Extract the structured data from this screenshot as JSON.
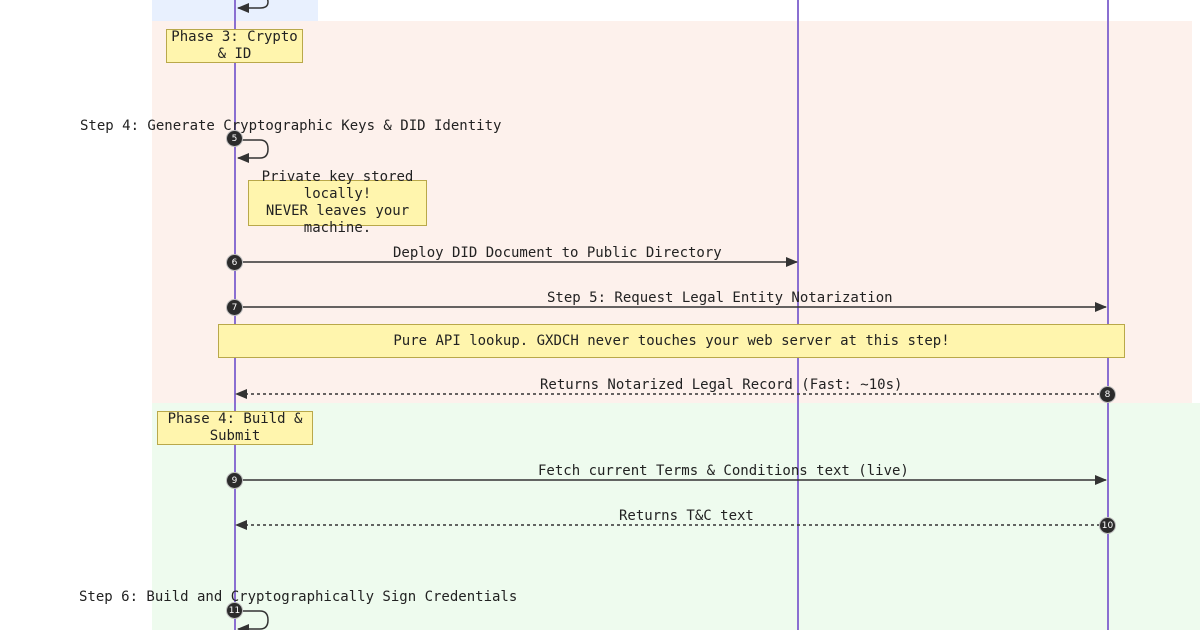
{
  "colors": {
    "band_top": "#e8f0fe",
    "band_phase3": "#fdf1ec",
    "band_phase4": "#eefbee",
    "note_fill": "#fff5ad",
    "lifeline": "#8a6fd1",
    "arrow": "#333333",
    "badge": "#2b2b2b"
  },
  "notes": {
    "phase3": "Phase 3: Crypto & ID",
    "private_key_line1": "Private key stored locally!",
    "private_key_line2": "NEVER leaves your machine.",
    "pure_api": "Pure API lookup. GXDCH never touches your web server at this step!",
    "phase4": "Phase 4: Build & Submit"
  },
  "messages": {
    "step4": "Step 4: Generate Cryptographic Keys & DID Identity",
    "deploy_did": "Deploy DID Document to Public Directory",
    "step5": "Step 5: Request Legal Entity Notarization",
    "returns_notarized": "Returns Notarized Legal Record (Fast: ~10s)",
    "fetch_tc": "Fetch current Terms & Conditions text (live)",
    "returns_tc": "Returns T&C text",
    "step6": "Step 6: Build and Cryptographically Sign Credentials"
  },
  "badges": {
    "b5": "5",
    "b6": "6",
    "b7": "7",
    "b8": "8",
    "b9": "9",
    "b10": "10",
    "b11": "11"
  }
}
